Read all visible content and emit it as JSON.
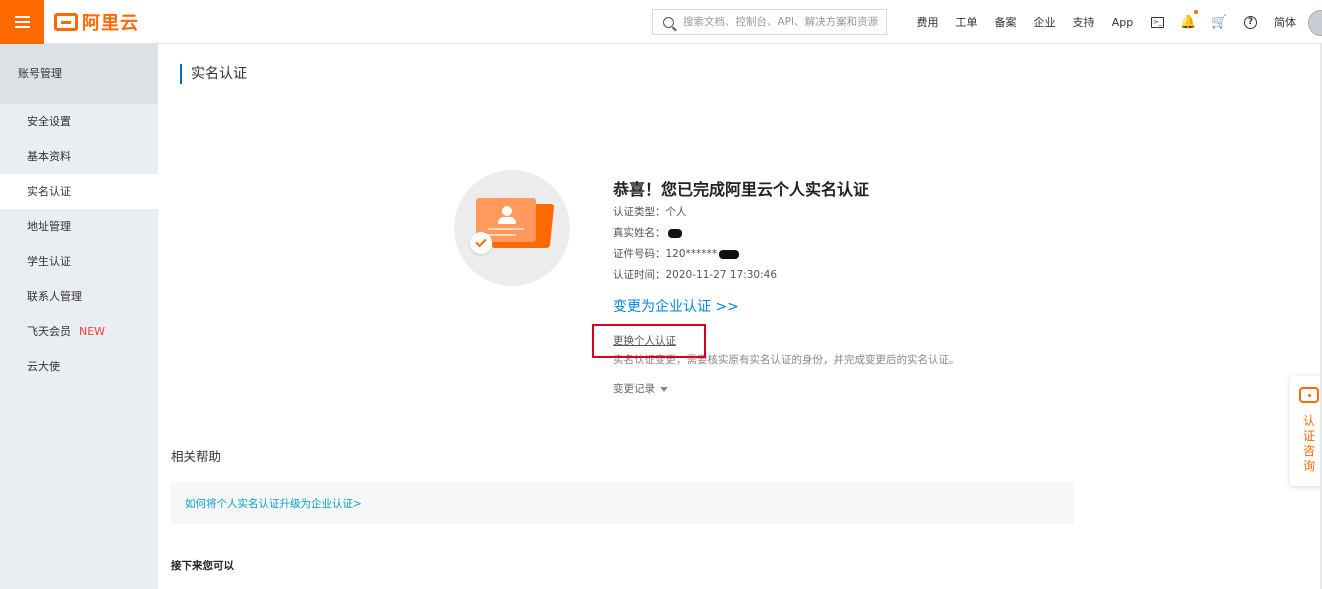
{
  "header": {
    "logo_text": "阿里云",
    "search_placeholder": "搜索文档、控制台、API、解决方案和资源",
    "links": [
      "费用",
      "工单",
      "备案",
      "企业",
      "支持",
      "App"
    ],
    "lang": "简体",
    "brand_color": "#ff6a00"
  },
  "sidebar": {
    "title": "账号管理",
    "items": [
      {
        "label": "安全设置"
      },
      {
        "label": "基本资料"
      },
      {
        "label": "实名认证"
      },
      {
        "label": "地址管理"
      },
      {
        "label": "学生认证"
      },
      {
        "label": "联系人管理"
      },
      {
        "label": "飞天会员",
        "badge": "NEW"
      },
      {
        "label": "云大使"
      }
    ],
    "active_index": 2
  },
  "main": {
    "page_title": "实名认证",
    "result_title": "恭喜！您已完成阿里云个人实名认证",
    "auth_type": "认证类型：个人",
    "real_name_label": "真实姓名：",
    "id_number": "证件号码：120******",
    "auth_time": "认证时间：2020-11-27 17:30:46",
    "upgrade_link": "变更为企业认证 >>",
    "change_personal_link": "更换个人认证",
    "change_desc": "实名认证变更，需要核实原有实名认证的身份，并完成变更后的实名认证。",
    "history_label": "变更记录",
    "help_title": "相关帮助",
    "help_link": "如何将个人实名认证升级为企业认证>",
    "next_title": "接下来您可以"
  },
  "consult": {
    "label": "认证咨询"
  }
}
